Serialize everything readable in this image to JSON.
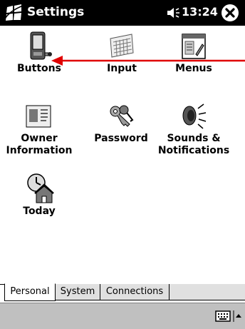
{
  "titlebar": {
    "title": "Settings",
    "time": "13:24"
  },
  "icons": [
    {
      "id": "buttons",
      "label_lines": [
        "Buttons"
      ]
    },
    {
      "id": "input",
      "label_lines": [
        "Input"
      ]
    },
    {
      "id": "menus",
      "label_lines": [
        "Menus"
      ]
    },
    {
      "id": "owner",
      "label_lines": [
        "Owner",
        "Information"
      ]
    },
    {
      "id": "password",
      "label_lines": [
        "Password"
      ]
    },
    {
      "id": "sounds",
      "label_lines": [
        "Sounds &",
        "Notifications"
      ]
    },
    {
      "id": "today",
      "label_lines": [
        "Today"
      ]
    }
  ],
  "tabs": [
    {
      "label": "Personal",
      "active": true
    },
    {
      "label": "System",
      "active": false
    },
    {
      "label": "Connections",
      "active": false
    }
  ],
  "colors": {
    "titlebar": "#000000",
    "annotation_arrow": "#e00000",
    "bottom_bar": "#c0c0c0"
  }
}
